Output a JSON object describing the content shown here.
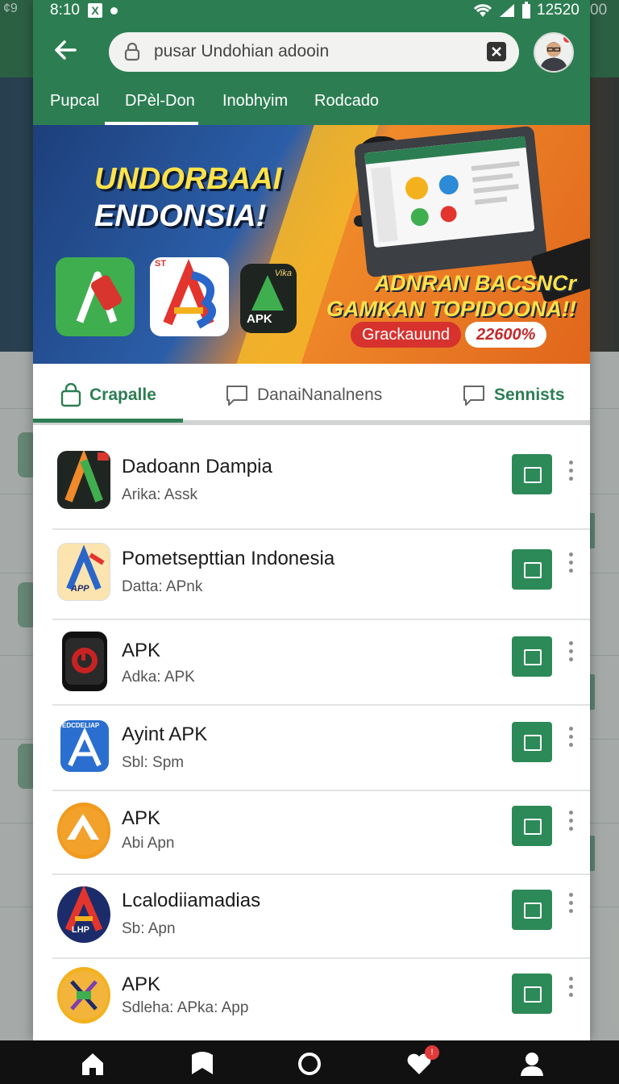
{
  "status_bar": {
    "ghost_left": "¢9",
    "time": "8:10",
    "sim_badge": "X",
    "ghost_right": "00",
    "battery_text": "12520"
  },
  "search": {
    "query": "pusar Undohian adooin"
  },
  "top_tabs": [
    {
      "label": "Pupcal"
    },
    {
      "label": "DPèl-Don"
    },
    {
      "label": "Inobhyim"
    },
    {
      "label": "Rodcado"
    }
  ],
  "banner": {
    "headline_line1": "UNDORBAAI",
    "headline_line2": "ENDONSIA!",
    "promo_line1": "ADNRAN BACSNCr",
    "promo_line2": "GAMKAN TOPIDOONA!!",
    "pill_label": "Grackauund",
    "pill_value": "22600%",
    "app_tile_badge": "ST",
    "app_tile_small_label": "Vika",
    "app_tile_apk": "APK"
  },
  "section_tabs": [
    {
      "label": "Crapalle"
    },
    {
      "label": "DanaiNanalnens"
    },
    {
      "label": "Sennists"
    }
  ],
  "apps": [
    {
      "title": "Dadoann Dampia",
      "subtitle": "Arika: Assk"
    },
    {
      "title": "Pometsepttian  Indonesia",
      "subtitle": "Datta: APnk",
      "icon_label": "APP"
    },
    {
      "title": "APK",
      "subtitle": "Adka: APK"
    },
    {
      "title": "Ayint APK",
      "subtitle": "Sbl: Spm",
      "icon_label": "EDCDELIAP"
    },
    {
      "title": "APK",
      "subtitle": "Abi Apn"
    },
    {
      "title": "Lcalodiiamadias",
      "subtitle": "Sb: Apn",
      "icon_label": "LHP"
    },
    {
      "title": "APK",
      "subtitle": "Sdleha: APka: App"
    }
  ],
  "colors": {
    "primary": "#2c7e52",
    "accent_yellow": "#ffe24a",
    "alert_red": "#d7322e"
  },
  "icons": {
    "back": "arrow-left-icon",
    "lock": "lock-icon",
    "clear": "close-box-icon",
    "tab_active": "bag-icon",
    "tab_mid": "chat-icon",
    "tab_right": "chat-icon",
    "row_action": "open-external-icon",
    "row_more": "more-vertical-icon",
    "nav": [
      "home-icon",
      "bookmark-icon",
      "record-icon",
      "heart-icon",
      "profile-icon"
    ]
  },
  "bottom_nav": {
    "badge": "!"
  }
}
